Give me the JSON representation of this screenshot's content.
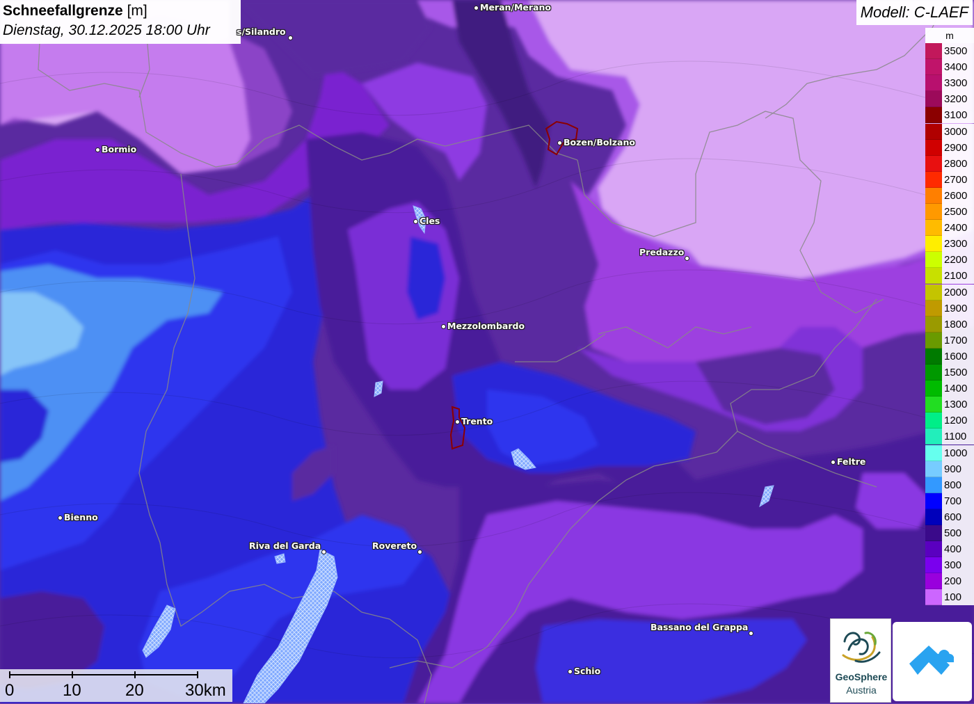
{
  "title": {
    "bold": "Schneefallgrenze",
    "unit": "[m]",
    "datetime": "Dienstag, 30.12.2025 18:00 Uhr"
  },
  "model_label": "Modell: C-LAEF",
  "legend": {
    "unit": "m",
    "entries": [
      {
        "label": "3500",
        "color": "#c2185b"
      },
      {
        "label": "3400",
        "color": "#c0146a"
      },
      {
        "label": "3300",
        "color": "#b8106e"
      },
      {
        "label": "3200",
        "color": "#9c0a5a"
      },
      {
        "label": "3100",
        "color": "#8b0000"
      },
      {
        "label": "3000",
        "color": "#b00000"
      },
      {
        "label": "2900",
        "color": "#d00000"
      },
      {
        "label": "2800",
        "color": "#e81010"
      },
      {
        "label": "2700",
        "color": "#ff2a00"
      },
      {
        "label": "2600",
        "color": "#ff7f00"
      },
      {
        "label": "2500",
        "color": "#ff9900"
      },
      {
        "label": "2400",
        "color": "#ffbb00"
      },
      {
        "label": "2300",
        "color": "#ffee00"
      },
      {
        "label": "2200",
        "color": "#ccff00"
      },
      {
        "label": "2100",
        "color": "#c8e000"
      },
      {
        "label": "2000",
        "color": "#c4c400"
      },
      {
        "label": "1900",
        "color": "#c09a00"
      },
      {
        "label": "1800",
        "color": "#9a9a00"
      },
      {
        "label": "1700",
        "color": "#6a9a00"
      },
      {
        "label": "1600",
        "color": "#007a00"
      },
      {
        "label": "1500",
        "color": "#009900"
      },
      {
        "label": "1400",
        "color": "#00bb00"
      },
      {
        "label": "1300",
        "color": "#22dd22"
      },
      {
        "label": "1200",
        "color": "#00ee88"
      },
      {
        "label": "1100",
        "color": "#22eebb"
      },
      {
        "label": "1000",
        "color": "#66ffee"
      },
      {
        "label": "900",
        "color": "#77ccff"
      },
      {
        "label": "800",
        "color": "#3399ff"
      },
      {
        "label": "700",
        "color": "#0000ff"
      },
      {
        "label": "600",
        "color": "#0000bb"
      },
      {
        "label": "500",
        "color": "#3a0a8a"
      },
      {
        "label": "400",
        "color": "#5a00c0"
      },
      {
        "label": "300",
        "color": "#7a00ee"
      },
      {
        "label": "200",
        "color": "#9900dd"
      },
      {
        "label": "100",
        "color": "#cc66ff"
      }
    ]
  },
  "cities": [
    {
      "name": "Meran/Merano"
    },
    {
      "name": "s/Silandro"
    },
    {
      "name": "Bormio"
    },
    {
      "name": "Bozen/Bolzano"
    },
    {
      "name": "Cles"
    },
    {
      "name": "Predazzo"
    },
    {
      "name": "Mezzolombardo"
    },
    {
      "name": "Trento"
    },
    {
      "name": "Feltre"
    },
    {
      "name": "Bienno"
    },
    {
      "name": "Riva del Garda"
    },
    {
      "name": "Rovereto"
    },
    {
      "name": "Bassano del Grappa"
    },
    {
      "name": "Schio"
    }
  ],
  "scalebar": {
    "labels": [
      "0",
      "10",
      "20",
      "30km"
    ]
  },
  "logos": {
    "geosphere_line1": "GeoSphere",
    "geosphere_line2": "Austria"
  }
}
